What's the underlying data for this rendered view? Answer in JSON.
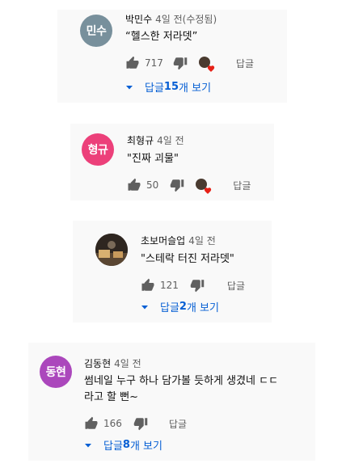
{
  "comments": [
    {
      "avatar_text": "민수",
      "avatar_color": "#78909c",
      "author": "박민수",
      "time": "4일 전(수정됨)",
      "text": "“헬스한 저라뎃”",
      "likes": "717",
      "reply_label": "답글",
      "replies": {
        "prefix": "답글 ",
        "count": "15",
        "suffix": "개 보기"
      }
    },
    {
      "avatar_text": "형규",
      "avatar_color": "#ec407a",
      "author": "최형규",
      "time": "4일 전",
      "text": "\"진짜 괴물\"",
      "likes": "50",
      "reply_label": "답글"
    },
    {
      "author": "초보머슬업",
      "time": "4일 전",
      "text": "\"스테락 터진 저라뎃\"",
      "likes": "121",
      "reply_label": "답글",
      "replies": {
        "prefix": "답글 ",
        "count": "2",
        "suffix": "개 보기"
      }
    },
    {
      "avatar_text": "동현",
      "avatar_color": "#ab47bc",
      "author": "김동현",
      "time": "4일 전",
      "text_line1": "썸네일 누구 하나 담가볼 듯하게 생겼네 ㄷㄷ",
      "text_line2": "라고 할 뻔~",
      "likes": "166",
      "reply_label": "답글",
      "replies": {
        "prefix": "답글 ",
        "count": "8",
        "suffix": "개 보기"
      }
    }
  ]
}
